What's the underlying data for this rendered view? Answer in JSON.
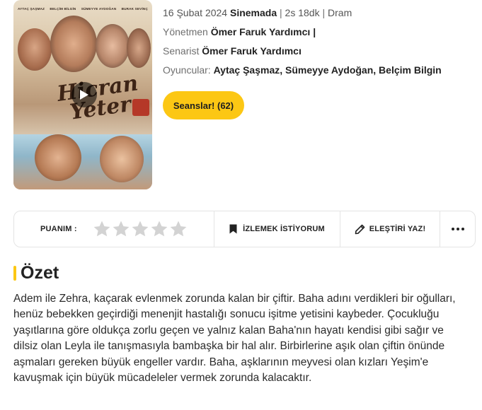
{
  "poster": {
    "cast_names": [
      "AYTAÇ ŞAŞMAZ",
      "BELÇİM BİLGİN",
      "SÜMEYYE AYDOĞAN",
      "BURAK SEVİNÇ"
    ],
    "title_art": "Hicran Yeter"
  },
  "movie": {
    "release_date": "16 Şubat 2024",
    "status": "Sinemada",
    "duration": "2s 18dk",
    "genre": "Dram",
    "director_label": "Yönetmen",
    "director": "Ömer Faruk Yardımcı",
    "writer_label": "Senarist",
    "writer": "Ömer Faruk Yardımcı",
    "cast_label": "Oyuncular:",
    "cast": [
      "Aytaç Şaşmaz",
      "Sümeyye Aydoğan",
      "Belçim Bilgin"
    ]
  },
  "buttons": {
    "showtimes": "Seanslar! (62)"
  },
  "action_bar": {
    "rating_label": "PUANIM :",
    "rating_value": 0,
    "rating_max": 5,
    "watchlist_label": "İZLEMEK İSTİYORUM",
    "review_label": "ELEŞTİRİ YAZ!",
    "more_icon": "more-dots-icon"
  },
  "summary": {
    "heading": "Özet",
    "text": "Adem ile Zehra, kaçarak evlenmek zorunda kalan bir çiftir. Baha adını verdikleri bir oğulları, henüz bebekken geçirdiği menenjit hastalığı sonucu işitme yetisini kaybeder. Çocukluğu yaşıtlarına göre oldukça zorlu geçen ve yalnız kalan Baha'nın hayatı kendisi gibi sağır ve dilsiz olan Leyla ile tanışmasıyla bambaşka bir hal alır. Birbirlerine aşık olan çiftin önünde aşmaları gereken büyük engeller vardır. Baha, aşklarının meyvesi olan kızları Yeşim'e kavuşmak için büyük mücadeleler vermek zorunda kalacaktır."
  },
  "colors": {
    "accent": "#fcc714",
    "star_empty": "#d3d3d3",
    "border": "#e4e4e4"
  }
}
